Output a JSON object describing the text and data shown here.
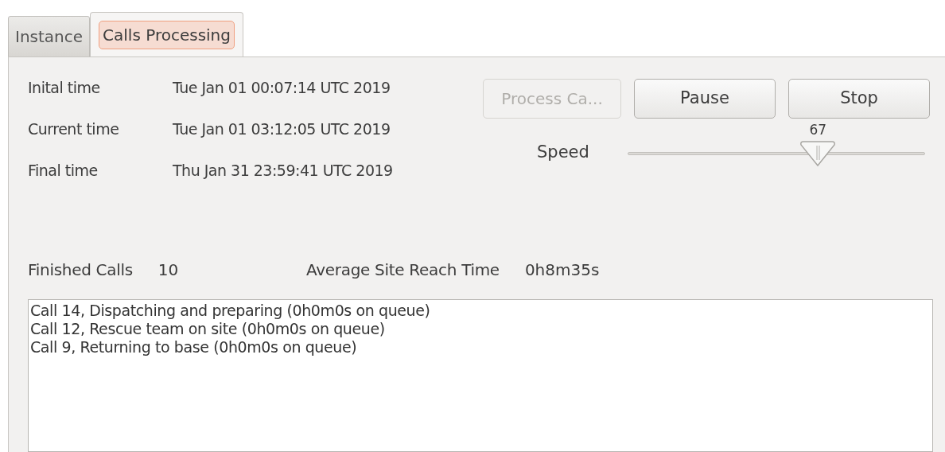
{
  "tabs": [
    {
      "label": "Instance",
      "selected": false
    },
    {
      "label": "Calls Processing",
      "selected": true
    }
  ],
  "times": [
    {
      "label": "Inital time",
      "value": "Tue Jan 01 00:07:14 UTC 2019"
    },
    {
      "label": "Current time",
      "value": "Tue Jan 01 03:12:05 UTC 2019"
    },
    {
      "label": "Final time",
      "value": "Thu Jan 31 23:59:41 UTC 2019"
    }
  ],
  "buttons": [
    {
      "label": "Process Ca...",
      "disabled": true
    },
    {
      "label": "Pause",
      "disabled": false
    },
    {
      "label": "Stop",
      "disabled": false
    }
  ],
  "speed": {
    "label": "Speed",
    "reading": "67",
    "level": 0.64
  },
  "stats": [
    {
      "label": "Finished Calls",
      "value": "10"
    },
    {
      "label": "Average Site Reach Time",
      "value": "0h8m35s"
    }
  ],
  "log": [
    "Call 14, Dispatching and preparing (0h0m0s on queue)",
    "Call 12, Rescue team on site (0h0m0s on queue)",
    "Call 9, Returning to base (0h0m0s on queue)"
  ]
}
